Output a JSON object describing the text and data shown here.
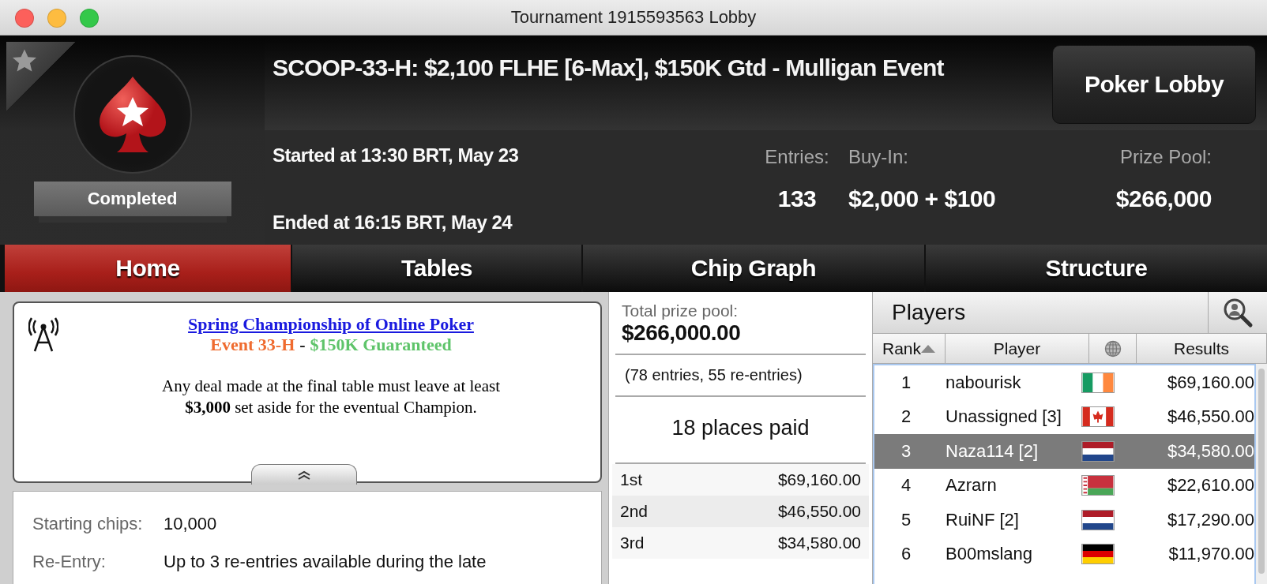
{
  "window": {
    "title": "Tournament 1915593563 Lobby"
  },
  "header": {
    "title": "SCOOP-33-H: $2,100 FLHE [6-Max], $150K Gtd - Mulligan Event",
    "status": "Completed",
    "favorite": false,
    "lobby_button": "Poker Lobby",
    "started": "Started at 13:30 BRT, May 23",
    "ended": "Ended at 16:15 BRT, May 24",
    "stats": [
      {
        "label": "Entries:",
        "value": "133"
      },
      {
        "label": "Buy-In:",
        "value": "$2,000 + $100"
      },
      {
        "label": "Prize Pool:",
        "value": "$266,000"
      }
    ]
  },
  "tabs": [
    {
      "label": "Home",
      "selected": true
    },
    {
      "label": "Tables",
      "selected": false
    },
    {
      "label": "Chip Graph",
      "selected": false
    },
    {
      "label": "Structure",
      "selected": false
    }
  ],
  "notice": {
    "link": "Spring Championship of Online Poker",
    "subtitle": [
      {
        "text": "Event 33-H",
        "color": "#ef6b2f"
      },
      {
        "text": "-",
        "color": "#111111"
      },
      {
        "text": "$150K Guaranteed",
        "color": "#5ec46a"
      }
    ],
    "body": "Any deal made at the final table must leave at least **$3,000** set aside for the eventual Champion."
  },
  "details": [
    {
      "label": "Starting chips:",
      "value": "10,000"
    },
    {
      "label": "Re-Entry:",
      "value": "Up to 3 re-entries available during the late"
    }
  ],
  "prize_panel": {
    "label": "Total prize pool:",
    "total": "$266,000.00",
    "entries": "(78 entries, 55 re-entries)",
    "places_paid": "18 places paid",
    "payouts": [
      {
        "place": "1st",
        "amount": "$69,160.00"
      },
      {
        "place": "2nd",
        "amount": "$46,550.00"
      },
      {
        "place": "3rd",
        "amount": "$34,580.00"
      }
    ]
  },
  "players": {
    "title": "Players",
    "columns": [
      "Rank",
      "Player",
      "Results"
    ],
    "rows": [
      {
        "rank": "1",
        "player": "nabourisk",
        "result": "$69,160.00",
        "selected": false,
        "flag": {
          "kind": "vertical",
          "stripes": [
            {
              "color": "#169b62"
            },
            {
              "color": "#ffffff"
            },
            {
              "color": "#ff883e"
            }
          ]
        }
      },
      {
        "rank": "2",
        "player": "Unassigned [3]",
        "result": "$46,550.00",
        "selected": false,
        "flag": {
          "kind": "maple",
          "stripes": [
            {
              "color": "#d52b1e"
            },
            {
              "color": "#ffffff"
            }
          ]
        }
      },
      {
        "rank": "3",
        "player": "Naza114 [2]",
        "result": "$34,580.00",
        "selected": true,
        "flag": {
          "kind": "horizontal",
          "stripes": [
            {
              "color": "#ae1c28"
            },
            {
              "color": "#ffffff"
            },
            {
              "color": "#21468b"
            }
          ]
        }
      },
      {
        "rank": "4",
        "player": "Azrarn",
        "result": "$22,610.00",
        "selected": false,
        "flag": {
          "kind": "hoist",
          "stripes": [
            {
              "color": "#c8313e"
            },
            {
              "color": "#4aa657"
            }
          ]
        }
      },
      {
        "rank": "5",
        "player": "RuiNF [2]",
        "result": "$17,290.00",
        "selected": false,
        "flag": {
          "kind": "horizontal",
          "stripes": [
            {
              "color": "#ae1c28"
            },
            {
              "color": "#ffffff"
            },
            {
              "color": "#21468b"
            }
          ]
        }
      },
      {
        "rank": "6",
        "player": "B00mslang",
        "result": "$11,970.00",
        "selected": false,
        "flag": {
          "kind": "horizontal",
          "stripes": [
            {
              "color": "#000000"
            },
            {
              "color": "#dd0000"
            },
            {
              "color": "#ffce00"
            }
          ]
        }
      }
    ]
  }
}
